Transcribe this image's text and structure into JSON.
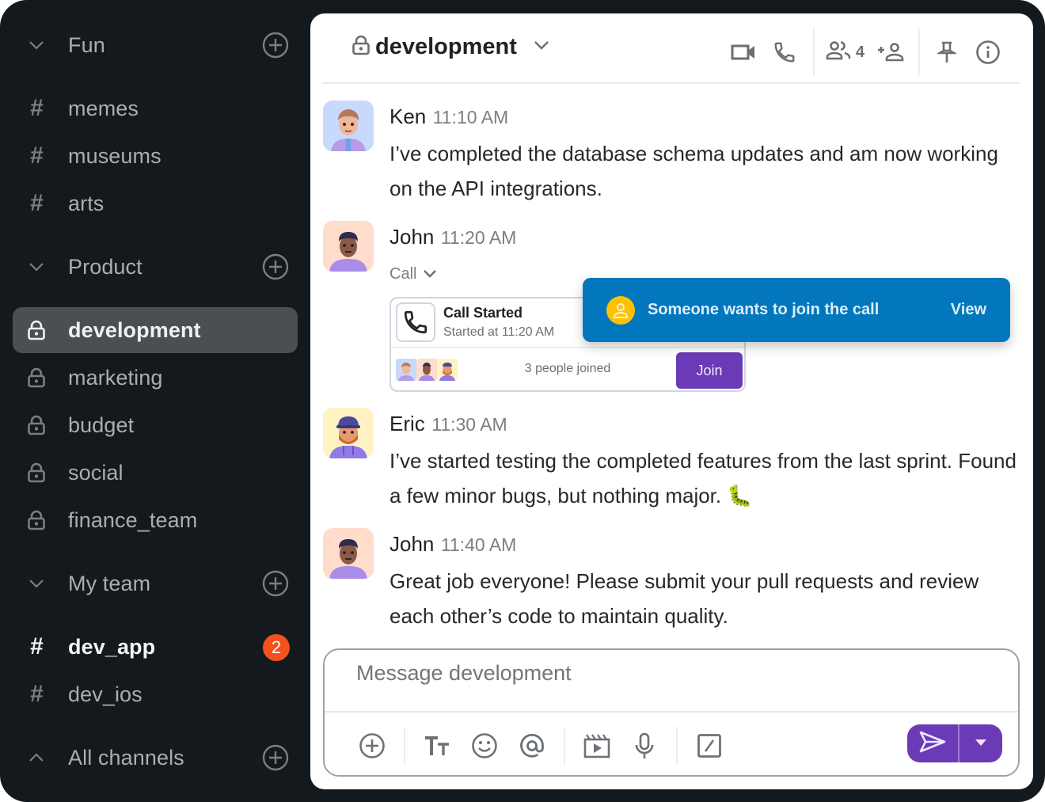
{
  "sidebar": {
    "sections": [
      {
        "label": "Fun",
        "expanded": true
      },
      {
        "label": "Product",
        "expanded": true
      },
      {
        "label": "My team",
        "expanded": true
      },
      {
        "label": "All channels",
        "expanded": false
      }
    ],
    "channels": {
      "fun": [
        {
          "label": "memes",
          "type": "public"
        },
        {
          "label": "museums",
          "type": "public"
        },
        {
          "label": "arts",
          "type": "public"
        }
      ],
      "product": [
        {
          "label": "development",
          "type": "private",
          "active": true
        },
        {
          "label": "marketing",
          "type": "private"
        },
        {
          "label": "budget",
          "type": "private"
        },
        {
          "label": "social",
          "type": "private"
        },
        {
          "label": "finance_team",
          "type": "private"
        }
      ],
      "my_team": [
        {
          "label": "dev_app",
          "type": "public",
          "unread": 2
        },
        {
          "label": "dev_ios",
          "type": "public"
        }
      ]
    }
  },
  "header": {
    "channel_name": "development",
    "member_count": "4",
    "icons": [
      "video-icon",
      "phone-icon",
      "members-icon",
      "add-member-icon",
      "pin-icon",
      "info-icon"
    ]
  },
  "messages": [
    {
      "author": "Ken",
      "time": "11:10 AM",
      "text": "I’ve completed the database schema updates and am now working on the API integrations.",
      "avatar_bg": "#c7dafc"
    },
    {
      "author": "John",
      "time": "11:20 AM",
      "call_toggle": "Call",
      "call": {
        "title": "Call Started",
        "subtitle": "Started at 11:20 AM",
        "joined": "3 people joined",
        "join_label": "Join"
      },
      "avatar_bg": "#ffdccb"
    },
    {
      "author": "Eric",
      "time": "11:30 AM",
      "text": "I’ve started testing the completed features from the last sprint. Found a few minor bugs, but nothing major. 🐛",
      "avatar_bg": "#fff3c4"
    },
    {
      "author": "John",
      "time": "11:40 AM",
      "text": "Great job everyone! Please submit your pull requests and review each other’s code to maintain quality.",
      "avatar_bg": "#ffdccb"
    }
  ],
  "toast": {
    "text": "Someone wants to join the call",
    "action": "View"
  },
  "composer": {
    "placeholder": "Message development",
    "value": ""
  },
  "colors": {
    "accent": "#6a3ab7",
    "toast": "#0277bd",
    "badge": "#f4511e",
    "sidebar_bg": "#13191c"
  }
}
